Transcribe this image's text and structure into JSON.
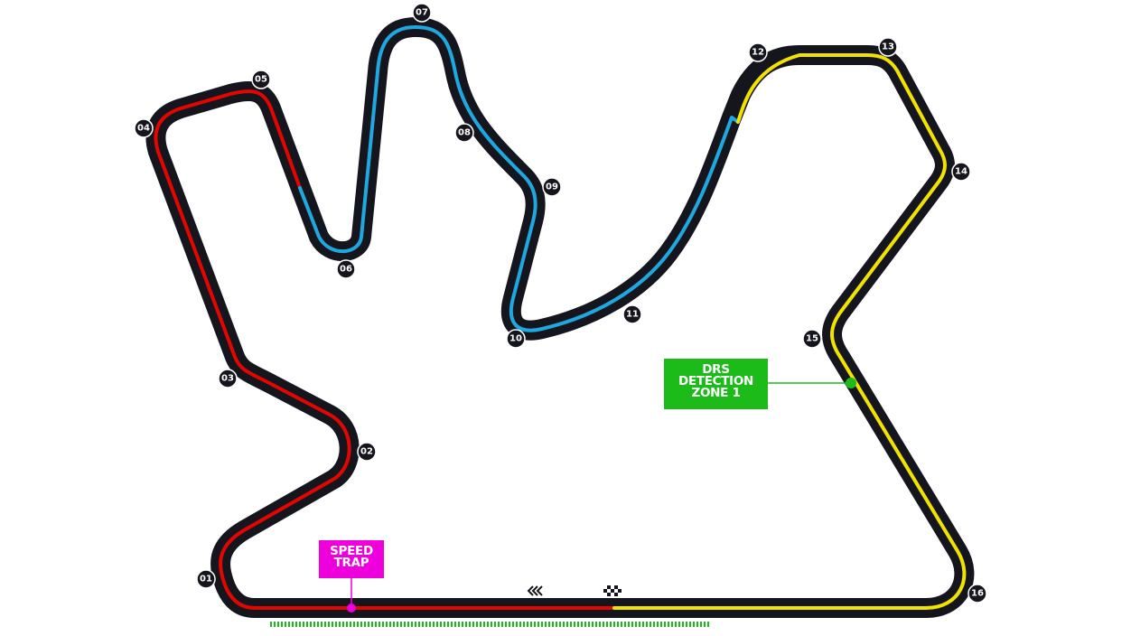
{
  "colors": {
    "track": "#15151e",
    "sector1": "#e10600",
    "sector2": "#1fa8e0",
    "sector3": "#f2e200",
    "drs": "#1dbb1a",
    "speed_trap": "#ee00dd",
    "badge_text": "#ffffff"
  },
  "turns": [
    "01",
    "02",
    "03",
    "04",
    "05",
    "06",
    "07",
    "08",
    "09",
    "10",
    "11",
    "12",
    "13",
    "14",
    "15",
    "16"
  ],
  "drs_detection": {
    "line1": "DRS",
    "line2": "DETECTION",
    "line3": "ZONE 1"
  },
  "speed_trap": {
    "line1": "SPEED",
    "line2": "TRAP"
  },
  "icons": {
    "direction": "direction-chevrons-icon",
    "finish": "chequered-flag-icon"
  }
}
